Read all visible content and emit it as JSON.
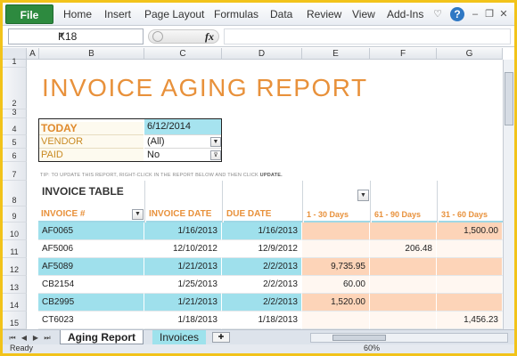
{
  "ribbon": {
    "file_label": "File",
    "tabs": [
      "Home",
      "Insert",
      "Page Layout",
      "Formulas",
      "Data",
      "Review",
      "View",
      "Add-Ins"
    ]
  },
  "formula_bar": {
    "name_box": "K18",
    "fx_label": "fx",
    "formula": ""
  },
  "columns": [
    "A",
    "B",
    "C",
    "D",
    "E",
    "F",
    "G"
  ],
  "rows": [
    "1",
    "2",
    "3",
    "4",
    "5",
    "6",
    "7",
    "8",
    "9",
    "10",
    "11",
    "12",
    "13",
    "14",
    "15"
  ],
  "report": {
    "title": "INVOICE  AGING  REPORT",
    "today_label": "TODAY",
    "today_value": "6/12/2014",
    "vendor_label": "VENDOR",
    "vendor_value": "(All)",
    "paid_label": "PAID",
    "paid_value": "No",
    "tip_text": "TIP: TO UPDATE THIS REPORT, RIGHT-CLICK IN THE REPORT BELOW AND THEN CLICK ",
    "tip_action": "UPDATE.",
    "table_title": "INVOICE  TABLE"
  },
  "table": {
    "headers": [
      "INVOICE #",
      "INVOICE DATE",
      "DUE DATE",
      "1 - 30 Days",
      "61 - 90 Days",
      "31 - 60 Days"
    ],
    "rows": [
      {
        "invoice": "AF0065",
        "invoice_date": "1/16/2013",
        "due_date": "1/16/2013",
        "d1_30": "",
        "d61_90": "",
        "d31_60": "1,500.00"
      },
      {
        "invoice": "AF5006",
        "invoice_date": "12/10/2012",
        "due_date": "12/9/2012",
        "d1_30": "",
        "d61_90": "206.48",
        "d31_60": ""
      },
      {
        "invoice": "AF5089",
        "invoice_date": "1/21/2013",
        "due_date": "2/2/2013",
        "d1_30": "9,735.95",
        "d61_90": "",
        "d31_60": ""
      },
      {
        "invoice": "CB2154",
        "invoice_date": "1/25/2013",
        "due_date": "2/2/2013",
        "d1_30": "60.00",
        "d61_90": "",
        "d31_60": ""
      },
      {
        "invoice": "CB2995",
        "invoice_date": "1/21/2013",
        "due_date": "2/2/2013",
        "d1_30": "1,520.00",
        "d61_90": "",
        "d31_60": ""
      },
      {
        "invoice": "CT6023",
        "invoice_date": "1/18/2013",
        "due_date": "1/18/2013",
        "d1_30": "",
        "d61_90": "",
        "d31_60": "1,456.23"
      }
    ]
  },
  "sheets": {
    "active": "Aging Report",
    "other": "Invoices"
  },
  "status": {
    "ready": "Ready",
    "zoom": "60%"
  },
  "colors": {
    "accent_orange": "#e8913b",
    "row_blue": "#9fe0ec",
    "aging_peach": "#fdd4b8",
    "file_green": "#2d8a3f",
    "frame_yellow": "#f2c31a"
  }
}
